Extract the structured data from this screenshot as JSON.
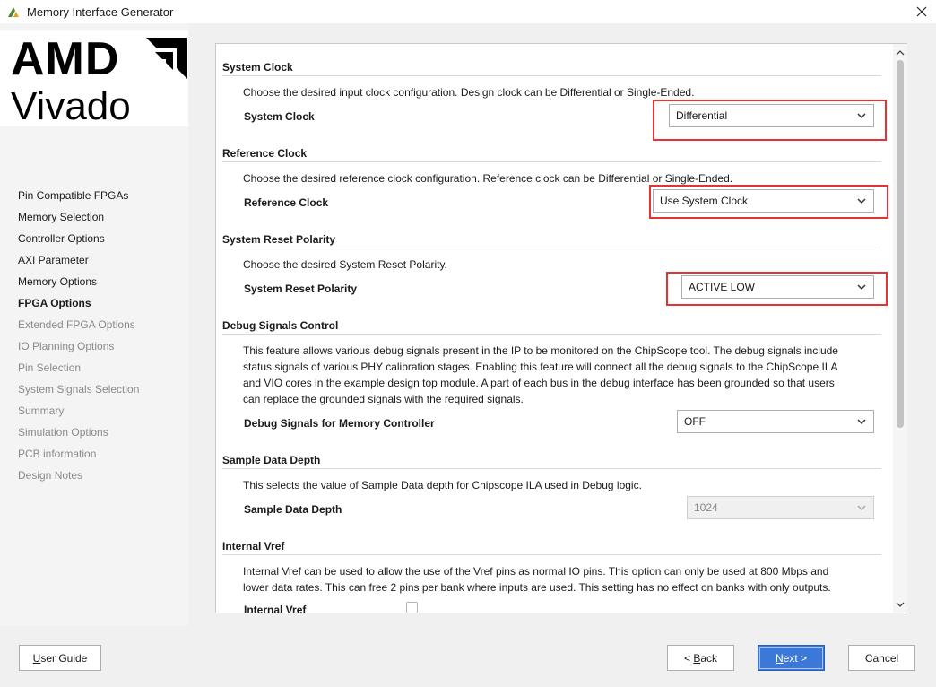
{
  "window": {
    "title": "Memory Interface Generator"
  },
  "logo": {
    "brand": "AMD",
    "product": "Vivado"
  },
  "nav": {
    "items": [
      {
        "label": "Pin Compatible FPGAs",
        "state": "done"
      },
      {
        "label": "Memory Selection",
        "state": "done"
      },
      {
        "label": "Controller Options",
        "state": "done"
      },
      {
        "label": "AXI Parameter",
        "state": "done"
      },
      {
        "label": "Memory Options",
        "state": "done"
      },
      {
        "label": "FPGA Options",
        "state": "active"
      },
      {
        "label": "Extended FPGA Options",
        "state": "disabled"
      },
      {
        "label": "IO Planning Options",
        "state": "disabled"
      },
      {
        "label": "Pin Selection",
        "state": "disabled"
      },
      {
        "label": "System Signals Selection",
        "state": "disabled"
      },
      {
        "label": "Summary",
        "state": "disabled"
      },
      {
        "label": "Simulation Options",
        "state": "disabled"
      },
      {
        "label": "PCB information",
        "state": "disabled"
      },
      {
        "label": "Design Notes",
        "state": "disabled"
      }
    ]
  },
  "sections": {
    "system_clock": {
      "title": "System Clock",
      "desc": "Choose the desired input clock configuration. Design clock can be Differential or Single-Ended.",
      "label": "System Clock",
      "value": "Differential"
    },
    "reference_clock": {
      "title": "Reference Clock",
      "desc": "Choose the desired reference clock configuration. Reference clock can be Differential or Single-Ended.",
      "label": "Reference Clock",
      "value": "Use System Clock"
    },
    "reset_polarity": {
      "title": "System Reset Polarity",
      "desc": "Choose the desired System Reset Polarity.",
      "label": "System Reset Polarity",
      "value": "ACTIVE LOW"
    },
    "debug": {
      "title": "Debug Signals Control",
      "desc_lines": [
        "This feature allows various debug signals present in the IP to be monitored on the ChipScope tool. The debug signals include",
        "status signals of various PHY calibration stages. Enabling this feature will connect all the debug signals to the ChipScope ILA",
        "and VIO cores in the example design top module. A part of each bus in the debug interface has been grounded so that users",
        "can replace the grounded signals with the required signals."
      ],
      "label": "Debug Signals for Memory Controller",
      "value": "OFF"
    },
    "sample_depth": {
      "title": "Sample Data Depth",
      "desc": "This selects the value of Sample Data depth for Chipscope ILA used in Debug logic.",
      "label": "Sample Data Depth",
      "value": "1024"
    },
    "internal_vref": {
      "title": "Internal Vref",
      "desc_lines": [
        "Internal Vref can be used to allow the use of the Vref pins as normal IO pins. This option can only be used at 800 Mbps and",
        "lower data rates. This can free 2 pins per bank where inputs are used. This setting has no effect on banks with only outputs."
      ],
      "label": "Internal Vref"
    }
  },
  "buttons": {
    "user_guide": {
      "pre": "",
      "u": "U",
      "post": "ser Guide"
    },
    "back": {
      "pre": "< ",
      "u": "B",
      "post": "ack"
    },
    "next": {
      "pre": "",
      "u": "N",
      "post": "ext >"
    },
    "cancel": "Cancel"
  },
  "colors": {
    "highlight": "#e53333",
    "primary_button": "#3c78d8"
  }
}
